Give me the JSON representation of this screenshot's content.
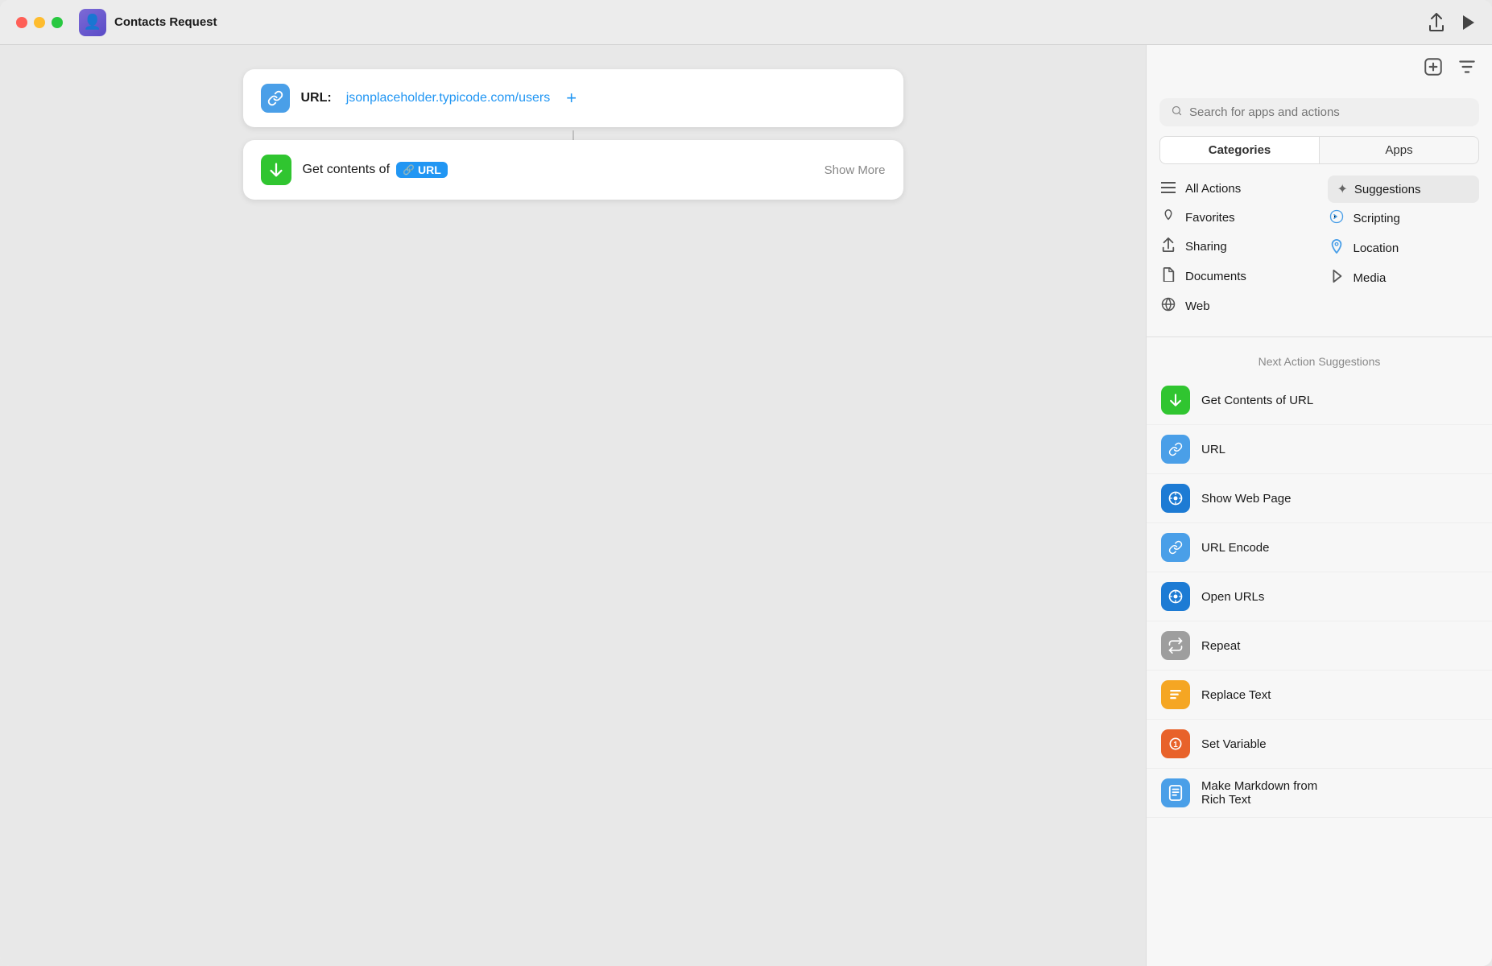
{
  "titlebar": {
    "app_title": "Contacts Request",
    "app_icon": "👤",
    "share_icon": "⬆",
    "play_icon": "▶"
  },
  "workflow": {
    "url_label": "URL:",
    "url_value": "jsonplaceholder.typicode.com/users",
    "url_add_label": "+",
    "action_label": "Get contents of",
    "action_url_tag": "URL",
    "action_show_more": "Show More"
  },
  "right_panel": {
    "search_placeholder": "Search for apps and actions",
    "tabs": [
      {
        "id": "categories",
        "label": "Categories",
        "active": true
      },
      {
        "id": "apps",
        "label": "Apps",
        "active": false
      }
    ],
    "categories": [
      {
        "icon": "≡",
        "label": "All Actions"
      },
      {
        "icon": "♡",
        "label": "Favorites"
      },
      {
        "icon": "↑",
        "label": "Sharing"
      },
      {
        "icon": "📄",
        "label": "Documents"
      },
      {
        "icon": "◎",
        "label": "Web"
      }
    ],
    "right_categories": [
      {
        "icon": "✦",
        "label": "Suggestions",
        "active": true
      },
      {
        "icon": "◈",
        "label": "Scripting"
      },
      {
        "icon": "↗",
        "label": "Location"
      },
      {
        "icon": "♪",
        "label": "Media"
      }
    ],
    "suggestions_header": "Next Action Suggestions",
    "suggestions": [
      {
        "icon_class": "sugg-icon-green",
        "icon_char": "⬇",
        "label": "Get Contents of URL",
        "multiline": false
      },
      {
        "icon_class": "sugg-icon-blue",
        "icon_char": "🔗",
        "label": "URL",
        "multiline": false
      },
      {
        "icon_class": "sugg-icon-safari",
        "icon_char": "◉",
        "label": "Show Web Page",
        "multiline": false
      },
      {
        "icon_class": "sugg-icon-blue-link",
        "icon_char": "🔗",
        "label": "URL Encode",
        "multiline": false
      },
      {
        "icon_class": "sugg-icon-safari",
        "icon_char": "◉",
        "label": "Open URLs",
        "multiline": false
      },
      {
        "icon_class": "sugg-icon-gray",
        "icon_char": "⟳",
        "label": "Repeat",
        "multiline": false
      },
      {
        "icon_class": "sugg-icon-yellow",
        "icon_char": "▤",
        "label": "Replace Text",
        "multiline": false
      },
      {
        "icon_class": "sugg-icon-orange",
        "icon_char": "①",
        "label": "Set Variable",
        "multiline": false
      },
      {
        "icon_class": "sugg-icon-blue-doc",
        "icon_char": "📋",
        "label": "Make Markdown from Rich Text",
        "multiline": true,
        "line1": "Make Markdown from",
        "line2": "Rich Text"
      }
    ]
  }
}
